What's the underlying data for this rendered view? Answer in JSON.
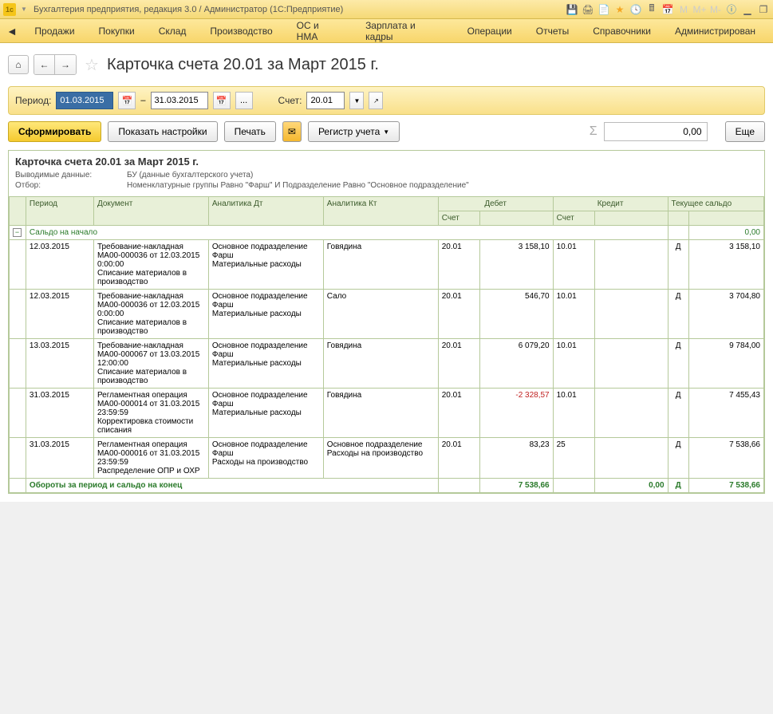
{
  "window_title": "Бухгалтерия предприятия, редакция 3.0 / Администратор  (1С:Предприятие)",
  "main_menu": [
    "Продажи",
    "Покупки",
    "Склад",
    "Производство",
    "ОС и НМА",
    "Зарплата и кадры",
    "Операции",
    "Отчеты",
    "Справочники",
    "Администрирован"
  ],
  "page_title": "Карточка счета 20.01 за Март 2015 г.",
  "filter": {
    "period_label": "Период:",
    "date_from": "01.03.2015",
    "date_to": "31.03.2015",
    "dash": "–",
    "dots": "...",
    "account_label": "Счет:",
    "account": "20.01"
  },
  "actions": {
    "form": "Сформировать",
    "show_settings": "Показать настройки",
    "print": "Печать",
    "register": "Регистр учета",
    "sum_value": "0,00",
    "more": "Еще"
  },
  "report": {
    "title": "Карточка счета 20.01 за Март 2015 г.",
    "sub1_label": "Выводимые данные:",
    "sub1_value": "БУ (данные бухгалтерского учета)",
    "sub2_label": "Отбор:",
    "sub2_value": "Номенклатурные группы Равно \"Фарш\" И Подразделение Равно \"Основное подразделение\"",
    "headers": {
      "period": "Период",
      "doc": "Документ",
      "adt": "Аналитика Дт",
      "akt": "Аналитика Кт",
      "debit": "Дебет",
      "credit": "Кредит",
      "balance": "Текущее сальдо",
      "acc": "Счет"
    },
    "opening": "Сальдо на начало",
    "opening_val": "0,00",
    "rows": [
      {
        "date": "12.03.2015",
        "doc": "Требование-накладная МА00-000036 от 12.03.2015 0:00:00\nСписание материалов в производство",
        "adt": "Основное подразделение\nФарш\nМатериальные расходы",
        "akt": "Говядина",
        "d_acc": "20.01",
        "d_val": "3 158,10",
        "c_acc": "10.01",
        "c_val": "",
        "dc": "Д",
        "bal": "3 158,10"
      },
      {
        "date": "12.03.2015",
        "doc": "Требование-накладная МА00-000036 от 12.03.2015 0:00:00\nСписание материалов в производство",
        "adt": "Основное подразделение\nФарш\nМатериальные расходы",
        "akt": "Сало",
        "d_acc": "20.01",
        "d_val": "546,70",
        "c_acc": "10.01",
        "c_val": "",
        "dc": "Д",
        "bal": "3 704,80"
      },
      {
        "date": "13.03.2015",
        "doc": "Требование-накладная МА00-000067 от 13.03.2015 12:00:00\nСписание материалов в производство",
        "adt": "Основное подразделение\nФарш\nМатериальные расходы",
        "akt": "Говядина",
        "d_acc": "20.01",
        "d_val": "6 079,20",
        "c_acc": "10.01",
        "c_val": "",
        "dc": "Д",
        "bal": "9 784,00"
      },
      {
        "date": "31.03.2015",
        "doc": "Регламентная операция МА00-000014 от 31.03.2015 23:59:59\nКорректировка стоимости списания",
        "adt": "Основное подразделение\nФарш\nМатериальные расходы",
        "akt": "Говядина",
        "d_acc": "20.01",
        "d_val": "-2 328,57",
        "d_neg": true,
        "c_acc": "10.01",
        "c_val": "",
        "dc": "Д",
        "bal": "7 455,43"
      },
      {
        "date": "31.03.2015",
        "doc": "Регламентная операция МА00-000016 от 31.03.2015 23:59:59\nРаспределение ОПР и ОХР",
        "adt": "Основное подразделение\nФарш\nРасходы на производство",
        "akt": "Основное подразделение\nРасходы на производство",
        "d_acc": "20.01",
        "d_val": "83,23",
        "c_acc": "25",
        "c_val": "",
        "dc": "Д",
        "bal": "7 538,66"
      }
    ],
    "closing": "Обороты за период и сальдо на конец",
    "closing_d": "7 538,66",
    "closing_c": "0,00",
    "closing_dc": "Д",
    "closing_bal": "7 538,66"
  }
}
